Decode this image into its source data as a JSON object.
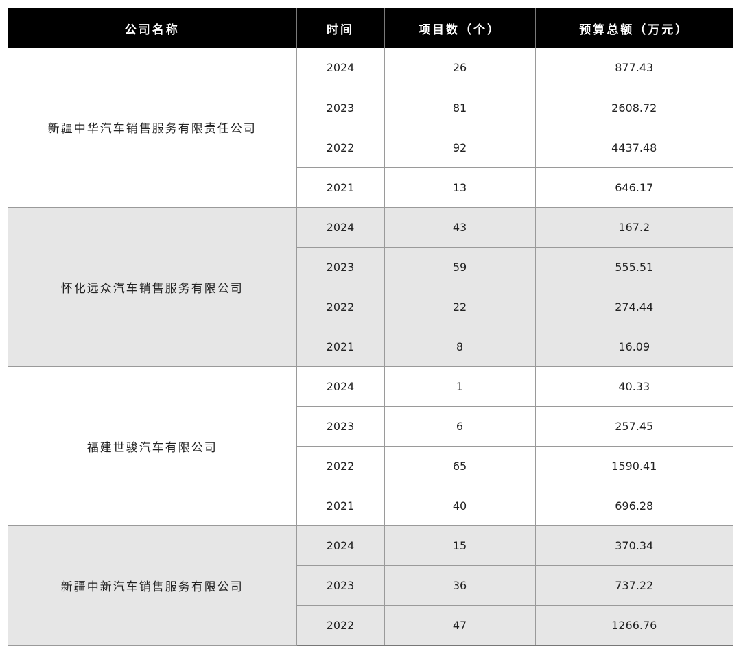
{
  "headers": {
    "company": "公司名称",
    "year": "时间",
    "count": "项目数（个）",
    "budget": "预算总额（万元）"
  },
  "groups": [
    {
      "company": "新疆中华汽车销售服务有限责任公司",
      "rows": [
        {
          "year": "2024",
          "count": "26",
          "budget": "877.43"
        },
        {
          "year": "2023",
          "count": "81",
          "budget": "2608.72"
        },
        {
          "year": "2022",
          "count": "92",
          "budget": "4437.48"
        },
        {
          "year": "2021",
          "count": "13",
          "budget": "646.17"
        }
      ]
    },
    {
      "company": "怀化远众汽车销售服务有限公司",
      "rows": [
        {
          "year": "2024",
          "count": "43",
          "budget": "167.2"
        },
        {
          "year": "2023",
          "count": "59",
          "budget": "555.51"
        },
        {
          "year": "2022",
          "count": "22",
          "budget": "274.44"
        },
        {
          "year": "2021",
          "count": "8",
          "budget": "16.09"
        }
      ]
    },
    {
      "company": "福建世骏汽车有限公司",
      "rows": [
        {
          "year": "2024",
          "count": "1",
          "budget": "40.33"
        },
        {
          "year": "2023",
          "count": "6",
          "budget": "257.45"
        },
        {
          "year": "2022",
          "count": "65",
          "budget": "1590.41"
        },
        {
          "year": "2021",
          "count": "40",
          "budget": "696.28"
        }
      ]
    },
    {
      "company": "新疆中新汽车销售服务有限公司",
      "rows": [
        {
          "year": "2024",
          "count": "15",
          "budget": "370.34"
        },
        {
          "year": "2023",
          "count": "36",
          "budget": "737.22"
        },
        {
          "year": "2022",
          "count": "47",
          "budget": "1266.76"
        }
      ]
    }
  ],
  "colors": {
    "header_bg": "#000000",
    "header_text": "#ffffff",
    "band_gray": "#e6e6e6",
    "band_white": "#ffffff"
  }
}
